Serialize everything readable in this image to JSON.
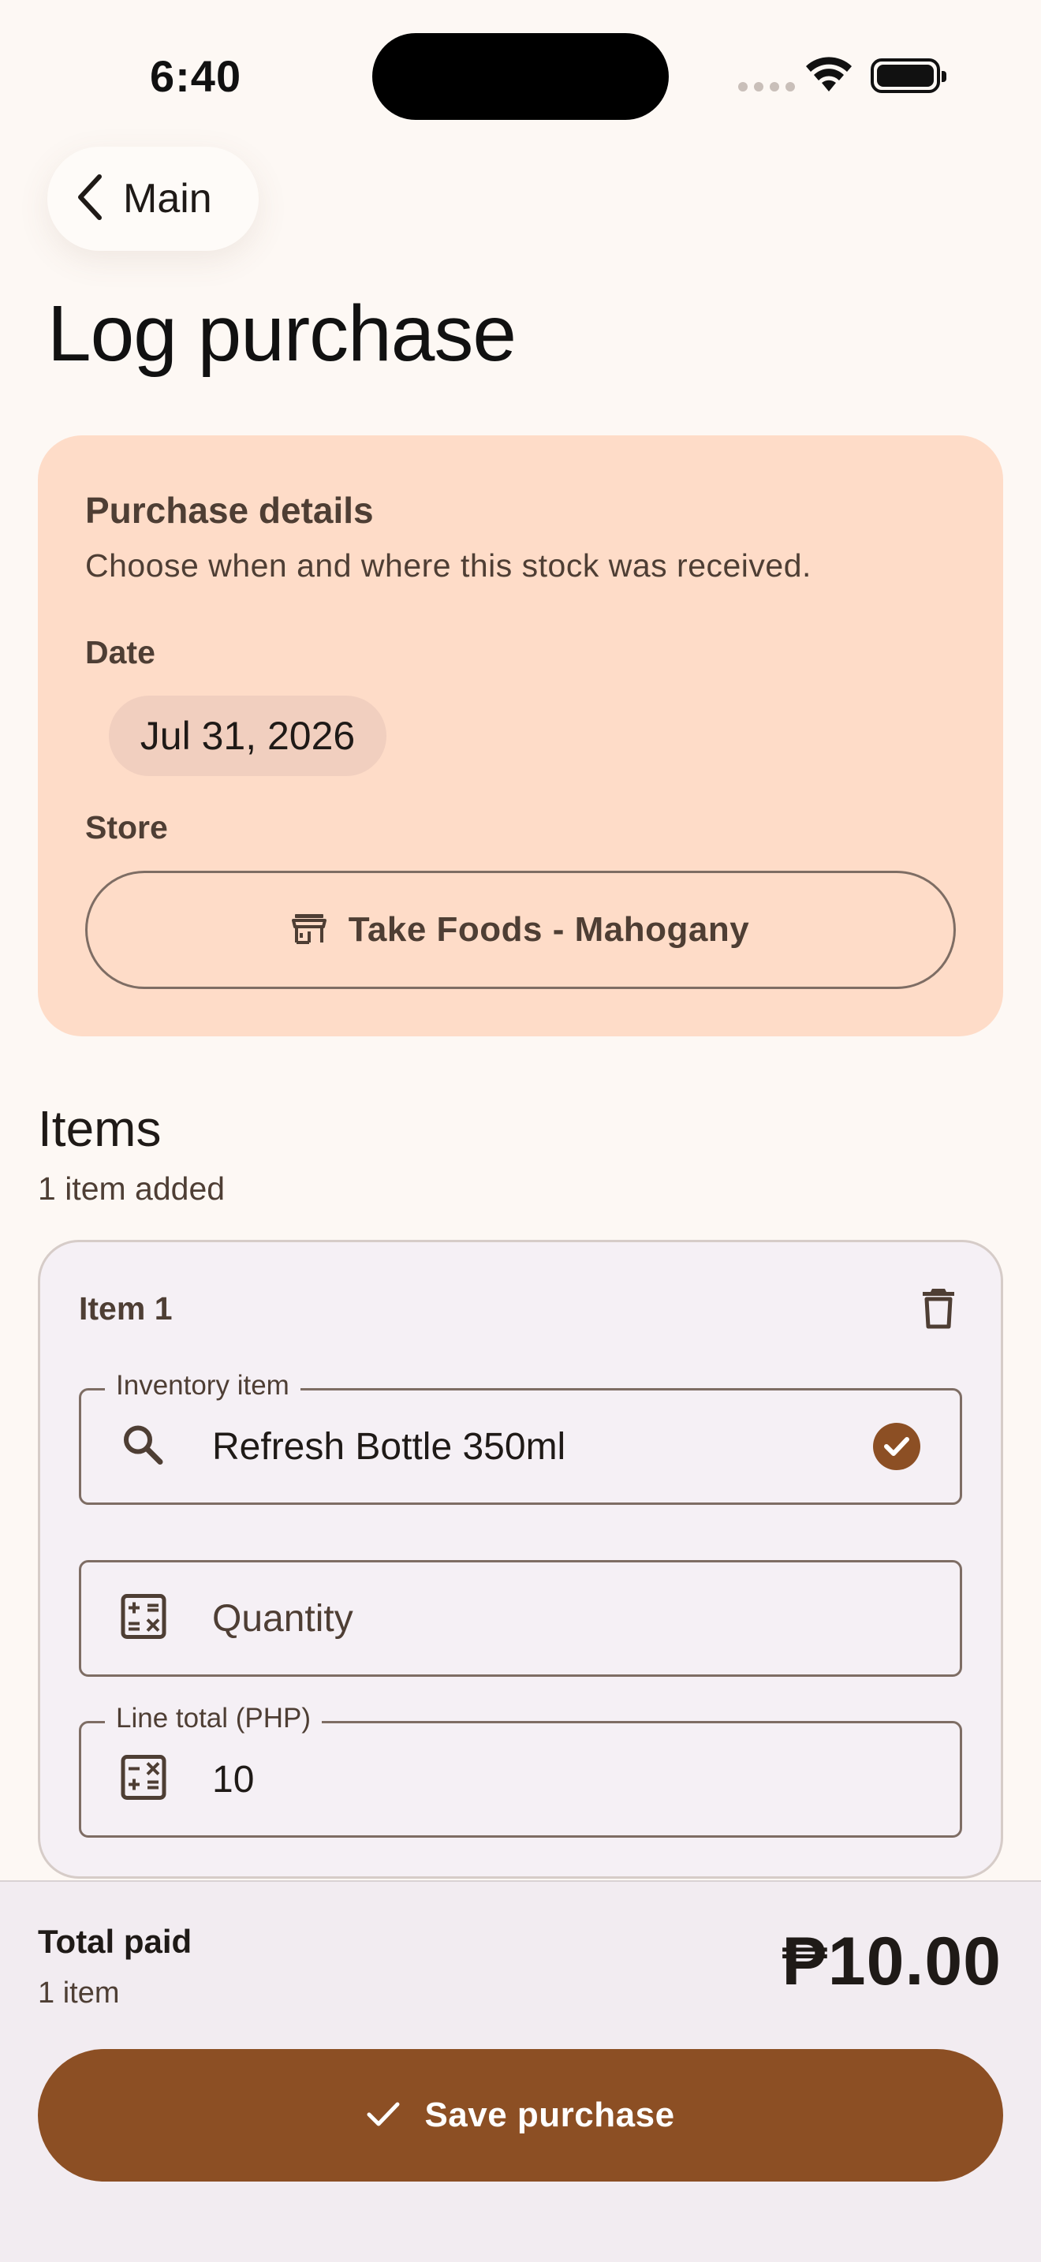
{
  "status_bar": {
    "time": "6:40"
  },
  "nav": {
    "back_label": "Main"
  },
  "page": {
    "title": "Log purchase"
  },
  "details": {
    "title": "Purchase details",
    "subtitle": "Choose when and where this stock was received.",
    "date_label": "Date",
    "date_value": "Jul 31, 2026",
    "store_label": "Store",
    "store_value": "Take Foods - Mahogany"
  },
  "items": {
    "title": "Items",
    "subtitle": "1 item added",
    "list": [
      {
        "title": "Item 1",
        "inventory_legend": "Inventory item",
        "inventory_value": "Refresh Bottle 350ml",
        "quantity_placeholder": "Quantity",
        "line_total_legend": "Line total (PHP)",
        "line_total_value": "10"
      }
    ]
  },
  "summary": {
    "total_label": "Total paid",
    "count": "1 item",
    "amount": "₱10.00",
    "save_label": "Save purchase"
  },
  "colors": {
    "background": "#FDF8F4",
    "details_card": "#FEDCC8",
    "accent": "#8C4F24",
    "bottom_bar": "#F2ECF1"
  },
  "icons": [
    "wifi-icon",
    "battery-icon",
    "chevron-left-icon",
    "store-icon",
    "trash-icon",
    "search-icon",
    "check-circle-icon",
    "calculator-icon",
    "check-icon"
  ]
}
